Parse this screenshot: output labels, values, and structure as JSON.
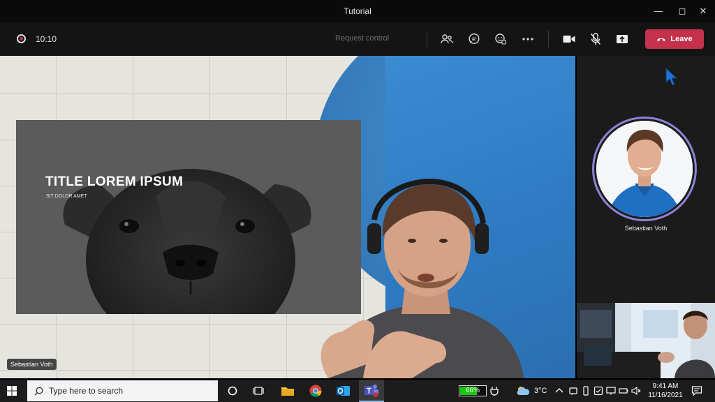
{
  "window": {
    "title": "Tutorial"
  },
  "toolbar": {
    "timer": "10:10",
    "request_control": "Request control",
    "leave_label": "Leave",
    "accent_color": "#c4314b"
  },
  "slide": {
    "title": "TITLE LOREM IPSUM",
    "subtitle": "SIT DOLOR AMET"
  },
  "presenter": {
    "name": "Sebastian Voth"
  },
  "participant": {
    "name": "Sebastian Voth"
  },
  "taskbar": {
    "search_placeholder": "Type here to search",
    "battery": "66%",
    "battery_level": 0.66,
    "temperature": "3°C",
    "time": "9:41 AM",
    "date": "11/16/2021"
  },
  "icons": [
    "people-icon",
    "chat-icon",
    "reactions-icon",
    "more-icon",
    "camera-icon",
    "mic-off-icon",
    "share-icon",
    "phone-hangup-icon"
  ]
}
